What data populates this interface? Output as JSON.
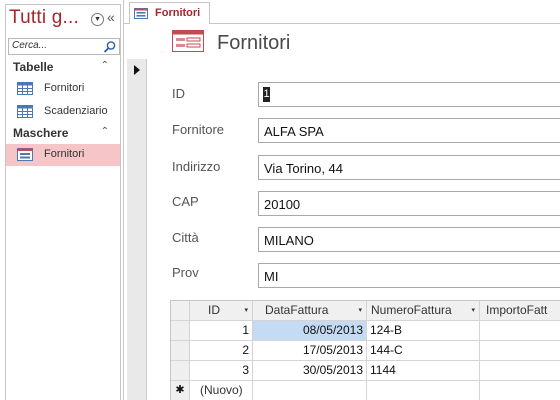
{
  "nav": {
    "title": "Tutti g...",
    "collapse_glyph": "«",
    "dropdown_glyph": "▼",
    "search_placeholder": "Cerca...",
    "groups": [
      {
        "label": "Tabelle",
        "chevron": "⌃",
        "items": [
          {
            "label": "Fornitori",
            "icon": "table-icon"
          },
          {
            "label": "Scadenziario",
            "icon": "table-icon"
          }
        ]
      },
      {
        "label": "Maschere",
        "chevron": "⌃",
        "items": [
          {
            "label": "Fornitori",
            "icon": "form-icon",
            "selected": true
          }
        ]
      }
    ]
  },
  "tab": {
    "label": "Fornitori"
  },
  "form": {
    "title": "Fornitori",
    "fields": [
      {
        "label": "ID",
        "value": "1"
      },
      {
        "label": "Fornitore",
        "value": "ALFA SPA"
      },
      {
        "label": "Indirizzo",
        "value": "Via Torino, 44"
      },
      {
        "label": "CAP",
        "value": "20100"
      },
      {
        "label": "Città",
        "value": "MILANO"
      },
      {
        "label": "Prov",
        "value": "MI"
      }
    ]
  },
  "subform": {
    "columns": [
      "ID",
      "DataFattura",
      "NumeroFattura",
      "ImportoFatt"
    ],
    "rows": [
      {
        "id": "1",
        "data": "08/05/2013",
        "numero": "124-B",
        "importo": ""
      },
      {
        "id": "2",
        "data": "17/05/2013",
        "numero": "144-C",
        "importo": ""
      },
      {
        "id": "3",
        "data": "30/05/2013",
        "numero": "1144",
        "importo": ""
      }
    ],
    "new_row_marker": "✱",
    "new_row_label": "(Nuovo)",
    "dropdown_glyph": "▾"
  },
  "colors": {
    "accent": "#a4262c",
    "selected_nav": "#f6c5c8",
    "cell_highlight": "#c5dbf3"
  }
}
